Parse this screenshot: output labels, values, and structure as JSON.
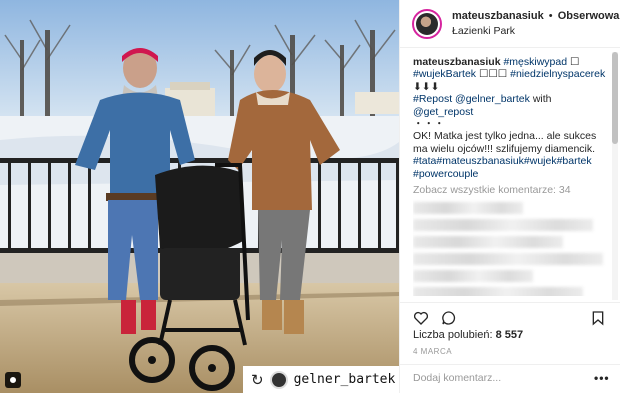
{
  "post": {
    "username": "mateuszbanasiuk",
    "separator": "•",
    "follow_label": "Obserwowanie",
    "location": "Łazienki Park"
  },
  "caption": {
    "username": "mateuszbanasiuk",
    "line1_tag1": "#męskiwypad",
    "line1_emoji": "☐",
    "line2_tag1": "#wujekBartek",
    "line2_emoji": "☐☐☐",
    "line2_tag2": "#niedzielnyspacerek",
    "arrows": "⬇⬇⬇",
    "repost_tag": "#Repost",
    "repost_user": "@gelner_bartek",
    "with_text": "with",
    "get_repost": "@get_repost",
    "dots": "・・・",
    "body": "OK! Matka jest tylko jedna... ale sukces ma wielu ojców!!! szlifujemy diamencik.",
    "hashtags": "#tata#mateuszbanasiuk#wujek#bartek #powercouple"
  },
  "comments_link": "Zobacz wszystkie komentarze: 34",
  "likes": {
    "label": "Liczba polubień:",
    "count": "8 557"
  },
  "date": "4 MARCA",
  "comment_placeholder": "Dodaj komentarz...",
  "more_options": "•••",
  "photo": {
    "repost_icon": "↻",
    "repost_username": "gelner_bartek"
  },
  "icons": [
    "heart-icon",
    "comment-icon",
    "bookmark-icon",
    "repost-icon",
    "user-tag-icon"
  ]
}
